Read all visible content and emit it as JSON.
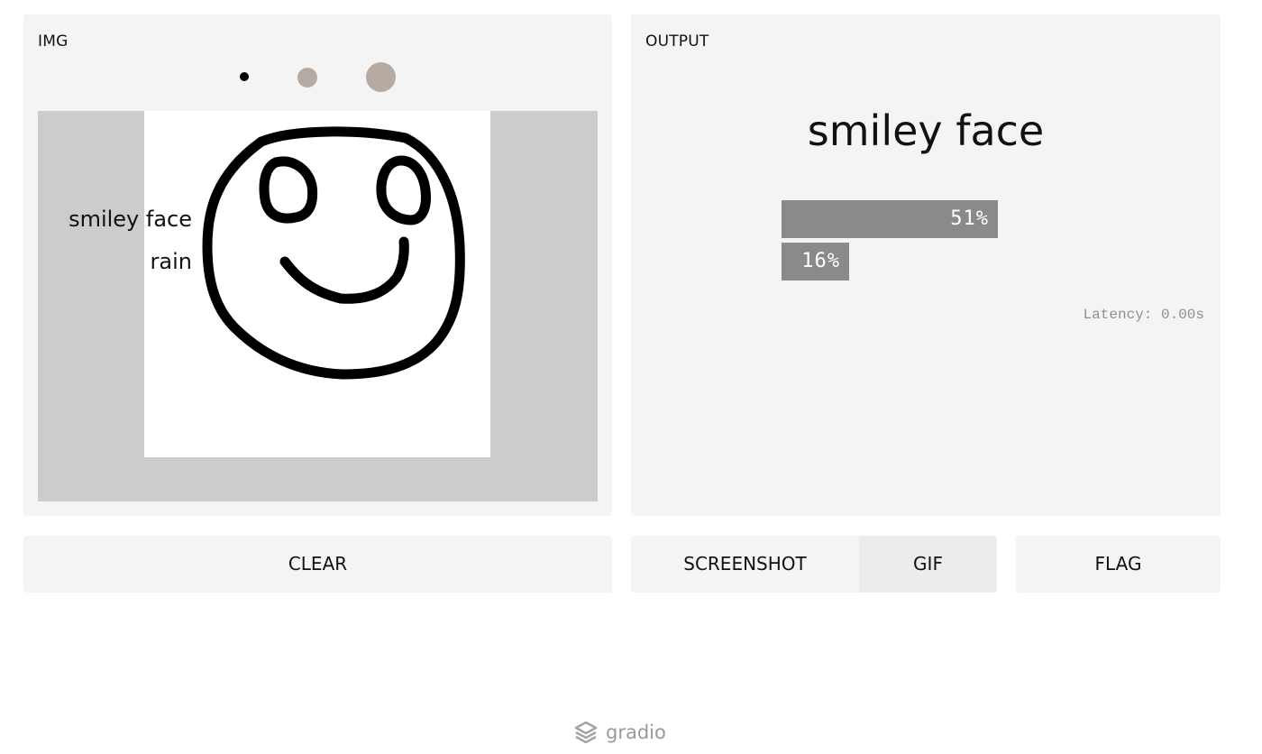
{
  "input": {
    "label": "IMG"
  },
  "output": {
    "label": "OUTPUT",
    "prediction": "smiley face",
    "confidences": [
      {
        "label": "smiley face",
        "value": 0.51,
        "display": "51%"
      },
      {
        "label": "rain",
        "value": 0.16,
        "display": "16%"
      }
    ],
    "latency": "Latency: 0.00s"
  },
  "brushes": {
    "colors": {
      "selected": "#000000",
      "unselected": "#b6aba3"
    }
  },
  "buttons": {
    "clear": "CLEAR",
    "screenshot": "SCREENSHOT",
    "gif": "GIF",
    "flag": "FLAG"
  },
  "footer": {
    "brand": "gradio",
    "logo_icon": "gradio-logo-icon"
  }
}
